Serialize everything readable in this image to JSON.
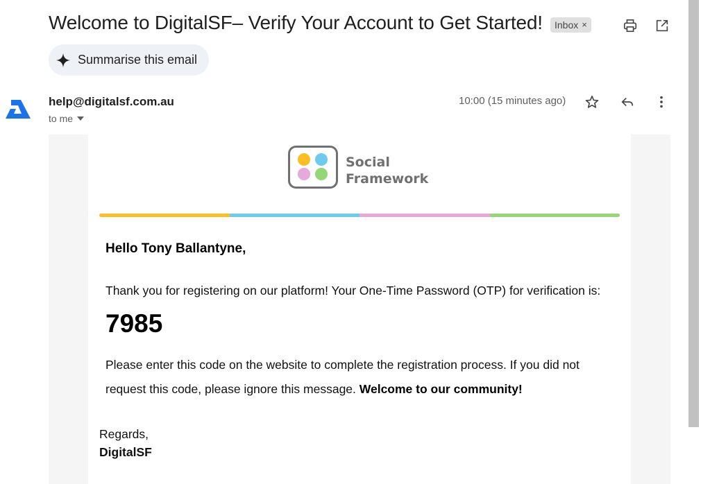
{
  "email": {
    "subject": "Welcome to DigitalSF– Verify Your Account to Get Started!",
    "label_badge": "Inbox",
    "label_remove": "×",
    "summarise_label": "Summarise this email",
    "sender": "help@digitalsf.com.au",
    "recipient": "to me",
    "time": "10:00 (15 minutes ago)"
  },
  "body": {
    "logo_text_line1": "Social",
    "logo_text_line2": "Framework",
    "greeting": "Hello Tony Ballantyne,",
    "thanks": "Thank you for registering on our platform! Your One-Time Password (OTP) for verification is:",
    "otp": "7985",
    "instructions": "Please enter this code on the website to complete the registration process. If you did not request this code, please ignore this message.",
    "welcome": "Welcome to our community!",
    "regards": "Regards,",
    "signature": "DigitalSF"
  },
  "colors": {
    "stripe": [
      "#fbbf24",
      "#6ccbef",
      "#e7a9d9",
      "#95d675"
    ],
    "avatar": "#1a73e8"
  },
  "icons": [
    "print-icon",
    "open-in-new-icon",
    "sparkle-icon",
    "star-icon",
    "reply-icon",
    "more-vert-icon",
    "chevron-down-icon"
  ]
}
